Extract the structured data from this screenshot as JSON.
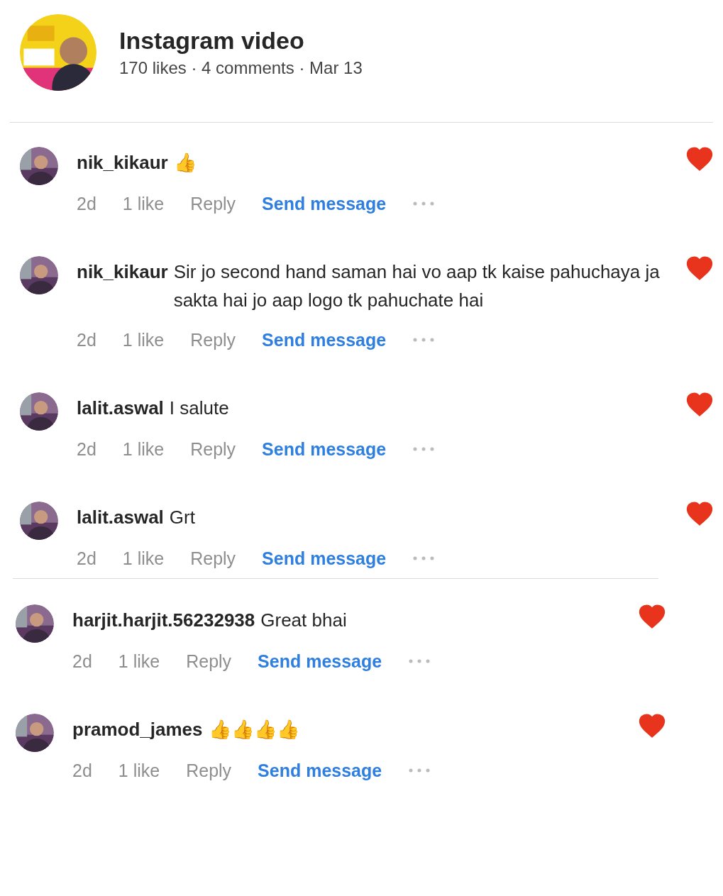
{
  "post": {
    "title": "Instagram video",
    "meta": "170 likes · 4 comments · Mar 13"
  },
  "threads": [
    {
      "comments": [
        {
          "user": "nik_kikaur",
          "text": "👍",
          "time": "2d",
          "likes": "1 like",
          "reply": "Reply",
          "message": "Send message",
          "liked": true
        },
        {
          "user": "nik_kikaur",
          "text": "Sir jo second hand saman hai vo aap tk kaise pahuchaya ja sakta hai jo aap logo tk pahuchate hai",
          "time": "2d",
          "likes": "1 like",
          "reply": "Reply",
          "message": "Send message",
          "liked": true
        },
        {
          "user": "lalit.aswal",
          "text": "I salute",
          "time": "2d",
          "likes": "1 like",
          "reply": "Reply",
          "message": "Send message",
          "liked": true
        },
        {
          "user": "lalit.aswal",
          "text": "Grt",
          "time": "2d",
          "likes": "1 like",
          "reply": "Reply",
          "message": "Send message",
          "liked": true
        }
      ]
    },
    {
      "comments": [
        {
          "user": "harjit.harjit.56232938",
          "text": "Great bhai",
          "time": "2d",
          "likes": "1 like",
          "reply": "Reply",
          "message": "Send message",
          "liked": true
        },
        {
          "user": "pramod_james",
          "text": "👍👍👍👍",
          "time": "2d",
          "likes": "1 like",
          "reply": "Reply",
          "message": "Send message",
          "liked": true
        }
      ]
    }
  ]
}
